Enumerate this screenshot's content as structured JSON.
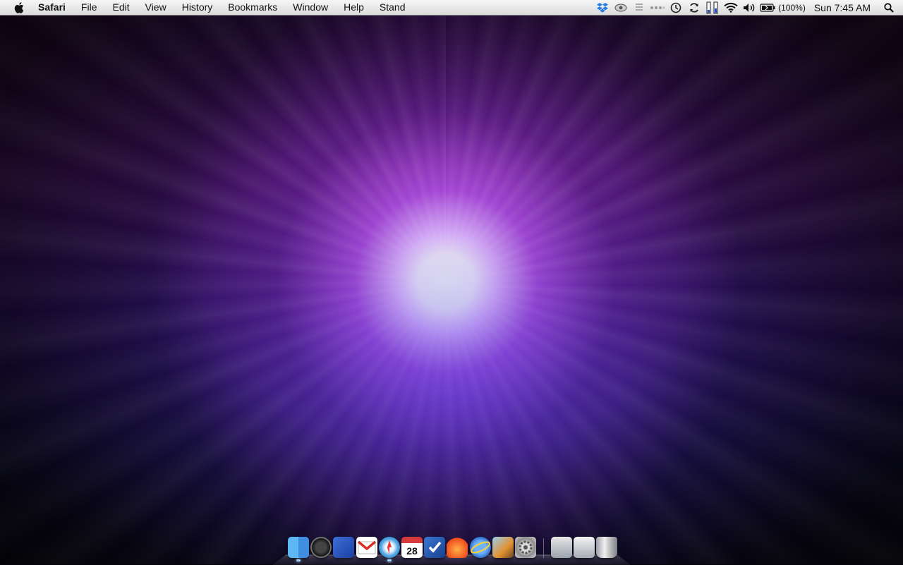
{
  "desktop": {
    "wallpaper": "purple-blue starburst",
    "colors": {
      "center": "#ffffff",
      "purple": "#b74de8",
      "blue": "#3b3be0",
      "dark": "#05030a"
    }
  },
  "menubar": {
    "apple_icon": "apple-logo-icon",
    "app_name": "Safari",
    "menus": [
      "File",
      "Edit",
      "View",
      "History",
      "Bookmarks",
      "Window",
      "Help",
      "Stand"
    ],
    "status_items": [
      {
        "name": "dropbox-icon"
      },
      {
        "name": "eye-icon"
      },
      {
        "name": "list-icon"
      },
      {
        "name": "bluetooth-dots-icon"
      },
      {
        "name": "time-machine-icon"
      },
      {
        "name": "sync-icon"
      },
      {
        "name": "usage-bars-icon"
      },
      {
        "name": "wifi-icon"
      },
      {
        "name": "volume-icon"
      },
      {
        "name": "battery-icon"
      }
    ],
    "battery_text": "(100%)",
    "clock": "Sun 7:45 AM",
    "spotlight_icon": "spotlight-search-icon"
  },
  "dock": {
    "apps": [
      {
        "name": "finder-icon",
        "running": true
      },
      {
        "name": "dashboard-icon",
        "running": false
      },
      {
        "name": "spaces-icon",
        "running": false
      },
      {
        "name": "gmail-icon",
        "running": false
      },
      {
        "name": "safari-icon",
        "running": true
      },
      {
        "name": "ical-icon",
        "running": false,
        "date": "28"
      },
      {
        "name": "things-icon",
        "running": false
      },
      {
        "name": "flower-app-icon",
        "running": false
      },
      {
        "name": "browser-globe-icon",
        "running": false
      },
      {
        "name": "iphoto-icon",
        "running": false
      },
      {
        "name": "system-preferences-icon",
        "running": false
      }
    ],
    "stacks": [
      {
        "name": "documents-stack-icon"
      },
      {
        "name": "downloads-stack-icon"
      },
      {
        "name": "trash-icon"
      }
    ]
  }
}
